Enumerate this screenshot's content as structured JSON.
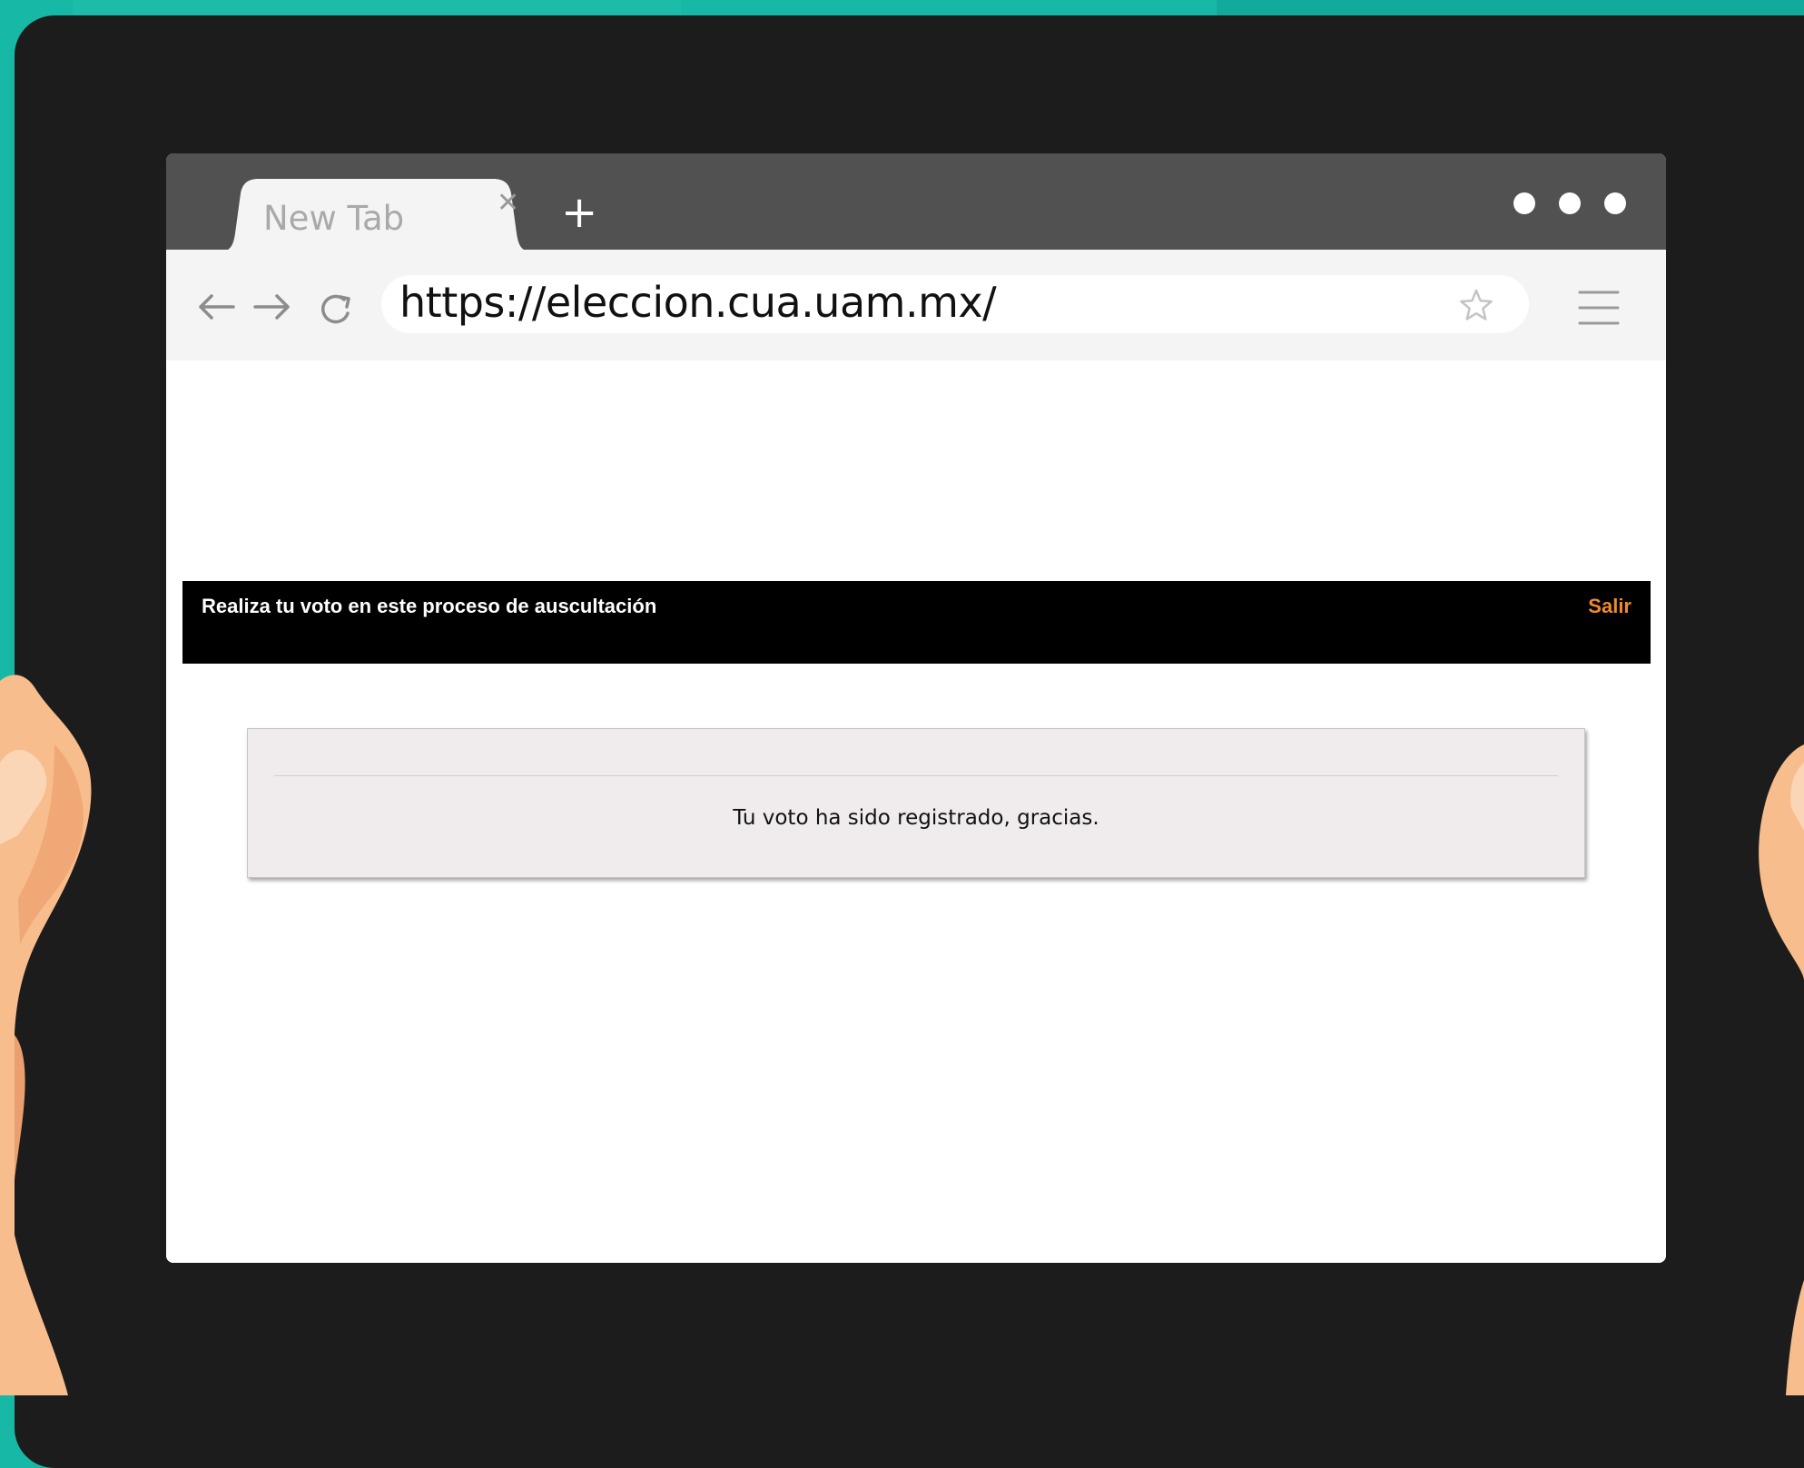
{
  "browser": {
    "tab": {
      "title": "New Tab",
      "close_icon": "close-icon"
    },
    "new_tab_icon": "plus-icon",
    "window_controls_icon": "three-dots-icon",
    "toolbar": {
      "back_icon": "arrow-left-icon",
      "forward_icon": "arrow-right-icon",
      "reload_icon": "reload-icon",
      "url": "https://eleccion.cua.uam.mx/",
      "bookmark_icon": "star-icon",
      "menu_icon": "hamburger-menu-icon"
    }
  },
  "page": {
    "header": {
      "title": "Realiza tu voto en este proceso de auscultación",
      "exit_label": "Salir",
      "exit_color": "#f08a2c"
    },
    "message": "Tu voto ha sido registrado, gracias."
  },
  "colors": {
    "background": "#17b8a6",
    "tablet_frame": "#1c1c1c",
    "tab_bar": "#515151",
    "toolbar": "#f4f4f4",
    "header_bar": "#000000",
    "card": "#f0eced",
    "skin": "#f7bd8c"
  }
}
